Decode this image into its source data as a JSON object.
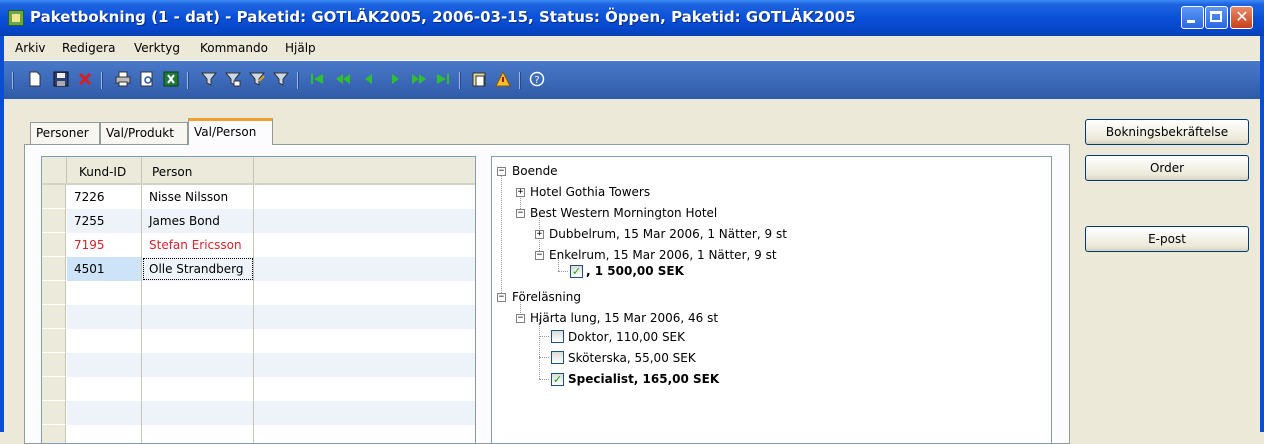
{
  "window": {
    "title": "Paketbokning (1 - dat) - Paketid: GOTLÄK2005, 2006-03-15, Status: Öppen, Paketid: GOTLÄK2005",
    "close_glyph": "✕"
  },
  "menu": [
    "Arkiv",
    "Redigera",
    "Verktyg",
    "Kommando",
    "Hjälp"
  ],
  "toolbar": {
    "icons": [
      "new-icon",
      "save-icon",
      "delete-icon",
      "print-icon",
      "print-preview-icon",
      "excel-icon",
      "filter-icon",
      "filter-field-icon",
      "filter-edit-icon",
      "filter-remove-icon",
      "first-record-icon",
      "previous-page-icon",
      "previous-record-icon",
      "next-record-icon",
      "next-page-icon",
      "last-record-icon",
      "paste-icon",
      "alert-icon",
      "help-icon"
    ]
  },
  "tabs": [
    "Personer",
    "Val/Produkt",
    "Val/Person"
  ],
  "active_tab": "Val/Person",
  "grid": {
    "columns": [
      "Kund-ID",
      "Person"
    ],
    "rows": [
      {
        "id": "7226",
        "name": "Nisse Nilsson"
      },
      {
        "id": "7255",
        "name": "James Bond"
      },
      {
        "id": "7195",
        "name": "Stefan Ericsson"
      },
      {
        "id": "4501",
        "name": "Olle Strandberg"
      }
    ]
  },
  "tree": {
    "boende": "Boende",
    "hotel1": "Hotel Gothia Towers",
    "hotel2": "Best Western Mornington Hotel",
    "room1": "Dubbelrum, 15 Mar 2006, 1 Nätter, 9 st",
    "room2": "Enkelrum, 15 Mar 2006, 1 Nätter, 9 st",
    "room2_price": ", 1 500,00 SEK",
    "forelasning": "Föreläsning",
    "lecture1": "Hjärta lung, 15 Mar 2006, 46 st",
    "opt1": "Doktor, 110,00 SEK",
    "opt2": "Sköterska, 55,00 SEK",
    "opt3": "Specialist, 165,00 SEK",
    "check_glyph": "✓",
    "plus": "+",
    "minus": "−"
  },
  "buttons": {
    "confirm": "Bokningsbekräftelse",
    "order": "Order",
    "email": "E-post"
  },
  "colors": {
    "title_blue": "#0a50d8",
    "highlight_red": "#e0202a",
    "tab_accent": "#f0a030"
  }
}
